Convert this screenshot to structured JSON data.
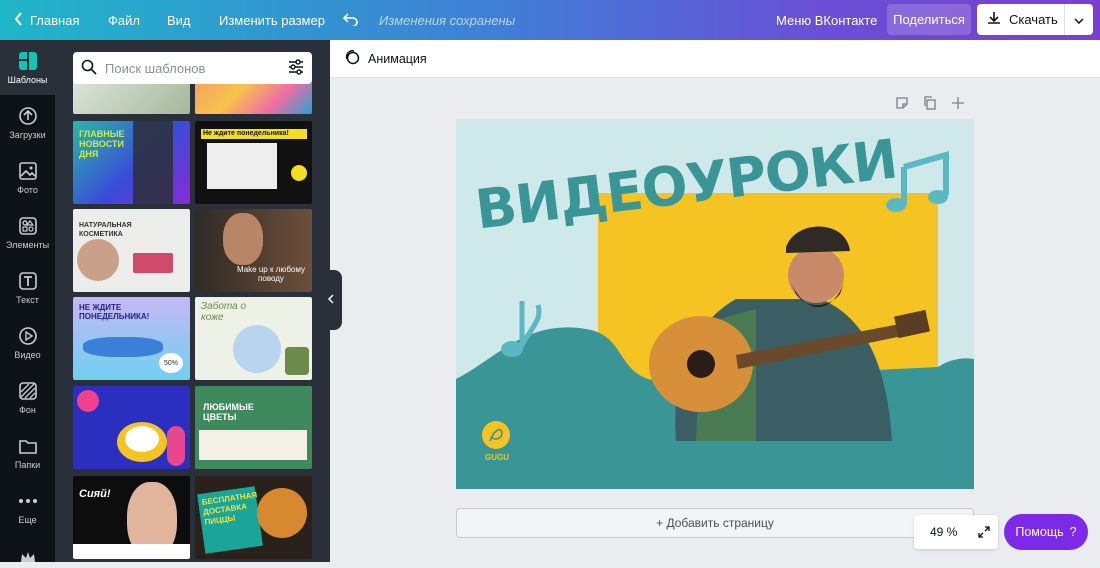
{
  "topbar": {
    "home_label": "Главная",
    "file_label": "Файл",
    "view_label": "Вид",
    "resize_label": "Изменить размер",
    "saved_status": "Изменения сохранены",
    "vk_menu_label": "Меню ВКонтакте",
    "share_label": "Поделиться",
    "download_label": "Скачать"
  },
  "sidebar": {
    "items": [
      {
        "label": "Шаблоны",
        "icon": "templates-icon"
      },
      {
        "label": "Загрузки",
        "icon": "upload-icon"
      },
      {
        "label": "Фото",
        "icon": "photo-icon"
      },
      {
        "label": "Элементы",
        "icon": "elements-icon"
      },
      {
        "label": "Текст",
        "icon": "text-icon"
      },
      {
        "label": "Видео",
        "icon": "video-icon"
      },
      {
        "label": "Фон",
        "icon": "background-icon"
      },
      {
        "label": "Папки",
        "icon": "folder-icon"
      },
      {
        "label": "Еще",
        "icon": "more-icon"
      }
    ]
  },
  "panel": {
    "search_placeholder": "Поиск шаблонов",
    "templates": [
      {
        "text": ""
      },
      {
        "text": ""
      },
      {
        "text": "ГЛАВНЫЕ НОВОСТИ ДНЯ"
      },
      {
        "text": "Не ждите понедельника!"
      },
      {
        "text": "НАТУРАЛЬНАЯ КОСМЕТИКА"
      },
      {
        "text": "Make up к любому поводу"
      },
      {
        "text": "НЕ ЖДИТЕ ПОНЕДЕЛЬНИКА!"
      },
      {
        "text": "Забота о коже"
      },
      {
        "text": ""
      },
      {
        "text": "ЛЮБИМЫЕ ЦВЕТЫ"
      },
      {
        "text": "Сияй!"
      },
      {
        "text": "БЕСПЛАТНАЯ ДОСТАВКА ПИЦЦЫ"
      }
    ]
  },
  "toolbar": {
    "animation_label": "Анимация"
  },
  "design": {
    "headline": "ВИДЕОУРОКИ",
    "logo_text": "GUGU"
  },
  "add_page_label": "+ Добавить страницу",
  "zoom_level": "49 %",
  "help_label": "Помощь",
  "help_icon": "?",
  "colors": {
    "accent": "#7d2ae8",
    "teal": "#3a9597",
    "yellow": "#f5c423",
    "mint": "#cfe8e9"
  }
}
